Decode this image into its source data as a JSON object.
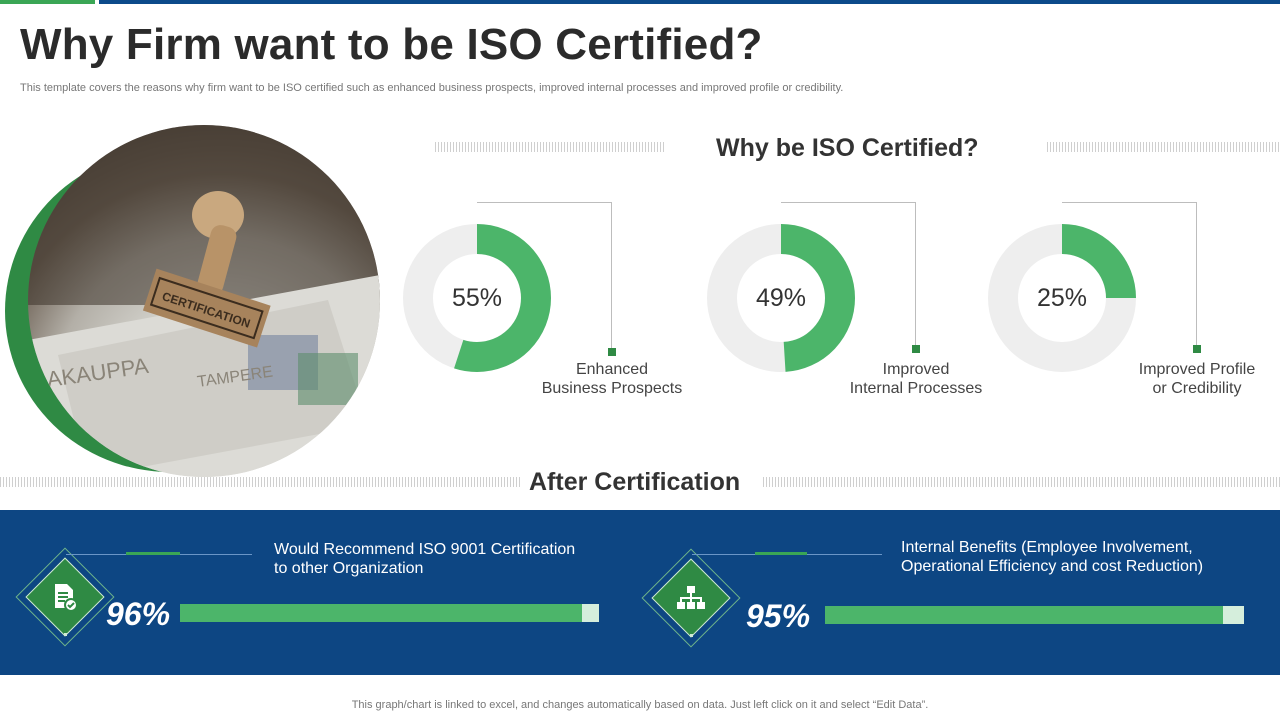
{
  "page": {
    "title": "Why Firm want to be ISO Certified?",
    "subtitle": "This template covers the reasons why firm want to be ISO certified such as enhanced business prospects, improved internal processes and improved profile or credibility.",
    "footer": "This graph/chart is linked to excel,  and changes automatically based on data. Just left click on it and select “Edit Data”."
  },
  "colors": {
    "accent_green": "#4cb56a",
    "dark_green": "#2f8a44",
    "band_blue": "#0d4683",
    "ring_gray": "#eeeeee"
  },
  "why_section": {
    "title": "Why be ISO Certified?",
    "metrics": [
      {
        "value": 55,
        "label": "55%",
        "caption": "Enhanced\nBusiness Prospects"
      },
      {
        "value": 49,
        "label": "49%",
        "caption": "Improved\nInternal  Processes"
      },
      {
        "value": 25,
        "label": "25%",
        "caption": "Improved Profile\nor Credibility"
      }
    ]
  },
  "after_section": {
    "title": "After Certification",
    "items": [
      {
        "icon": "document-check-icon",
        "text": "Would Recommend ISO  9001 Certification\nto other Organization",
        "value": 96,
        "label": "96%"
      },
      {
        "icon": "org-chart-icon",
        "text": "Internal  Benefits (Employee Involvement,\nOperational Efficiency and cost Reduction)",
        "value": 95,
        "label": "95%"
      }
    ]
  }
}
